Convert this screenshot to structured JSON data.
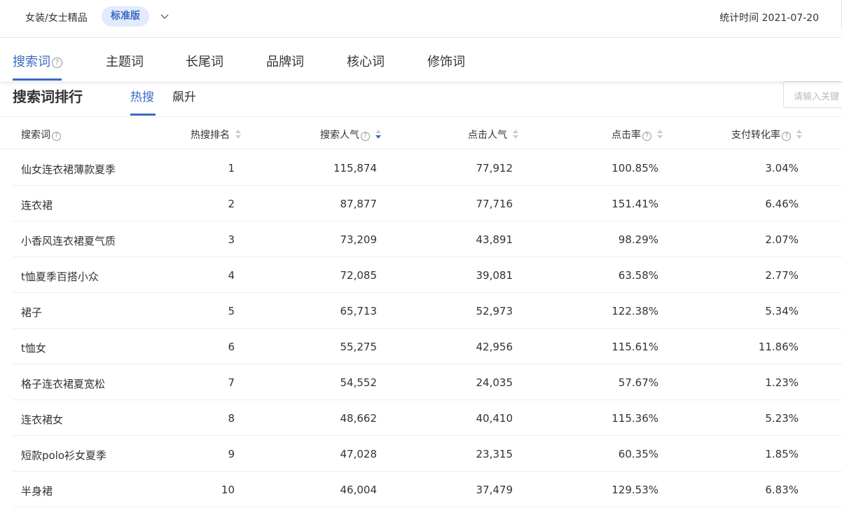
{
  "header": {
    "category": "女装/女士精品",
    "edition_badge": "标准版",
    "stat_time": "统计时间 2021-07-20"
  },
  "tabs": [
    {
      "label": "搜索词",
      "active": true,
      "has_help": true
    },
    {
      "label": "主题词"
    },
    {
      "label": "长尾词"
    },
    {
      "label": "品牌词"
    },
    {
      "label": "核心词"
    },
    {
      "label": "修饰词"
    }
  ],
  "section": {
    "title": "搜索词排行",
    "subtabs": [
      {
        "label": "热搜",
        "active": true
      },
      {
        "label": "飙升"
      }
    ],
    "search_placeholder": "请输入关键"
  },
  "table": {
    "columns": [
      {
        "label": "搜索词",
        "help": true,
        "sortable": false
      },
      {
        "label": "热搜排名",
        "sortable": true
      },
      {
        "label": "搜索人气",
        "help": true,
        "sortable": true,
        "sort": "desc"
      },
      {
        "label": "点击人气",
        "sortable": true
      },
      {
        "label": "点击率",
        "help": true,
        "sortable": true
      },
      {
        "label": "支付转化率",
        "help": true,
        "sortable": true
      }
    ],
    "rows": [
      {
        "keyword": "仙女连衣裙薄款夏季",
        "rank": "1",
        "search_pop": "115,874",
        "click_pop": "77,912",
        "ctr": "100.85%",
        "cvr": "3.04%"
      },
      {
        "keyword": "连衣裙",
        "rank": "2",
        "search_pop": "87,877",
        "click_pop": "77,716",
        "ctr": "151.41%",
        "cvr": "6.46%"
      },
      {
        "keyword": "小香风连衣裙夏气质",
        "rank": "3",
        "search_pop": "73,209",
        "click_pop": "43,891",
        "ctr": "98.29%",
        "cvr": "2.07%"
      },
      {
        "keyword": "t恤夏季百搭小众",
        "rank": "4",
        "search_pop": "72,085",
        "click_pop": "39,081",
        "ctr": "63.58%",
        "cvr": "2.77%"
      },
      {
        "keyword": "裙子",
        "rank": "5",
        "search_pop": "65,713",
        "click_pop": "52,973",
        "ctr": "122.38%",
        "cvr": "5.34%"
      },
      {
        "keyword": "t恤女",
        "rank": "6",
        "search_pop": "55,275",
        "click_pop": "42,956",
        "ctr": "115.61%",
        "cvr": "11.86%"
      },
      {
        "keyword": "格子连衣裙夏宽松",
        "rank": "7",
        "search_pop": "54,552",
        "click_pop": "24,035",
        "ctr": "57.67%",
        "cvr": "1.23%"
      },
      {
        "keyword": "连衣裙女",
        "rank": "8",
        "search_pop": "48,662",
        "click_pop": "40,410",
        "ctr": "115.36%",
        "cvr": "5.23%"
      },
      {
        "keyword": "短款polo衫女夏季",
        "rank": "9",
        "search_pop": "47,028",
        "click_pop": "23,315",
        "ctr": "60.35%",
        "cvr": "1.85%"
      },
      {
        "keyword": "半身裙",
        "rank": "10",
        "search_pop": "46,004",
        "click_pop": "37,479",
        "ctr": "129.53%",
        "cvr": "6.83%"
      }
    ]
  },
  "colors": {
    "accent": "#3d69c5",
    "badge_bg": "#e2ebfb",
    "text": "#333333",
    "divider": "#eeeeee"
  }
}
